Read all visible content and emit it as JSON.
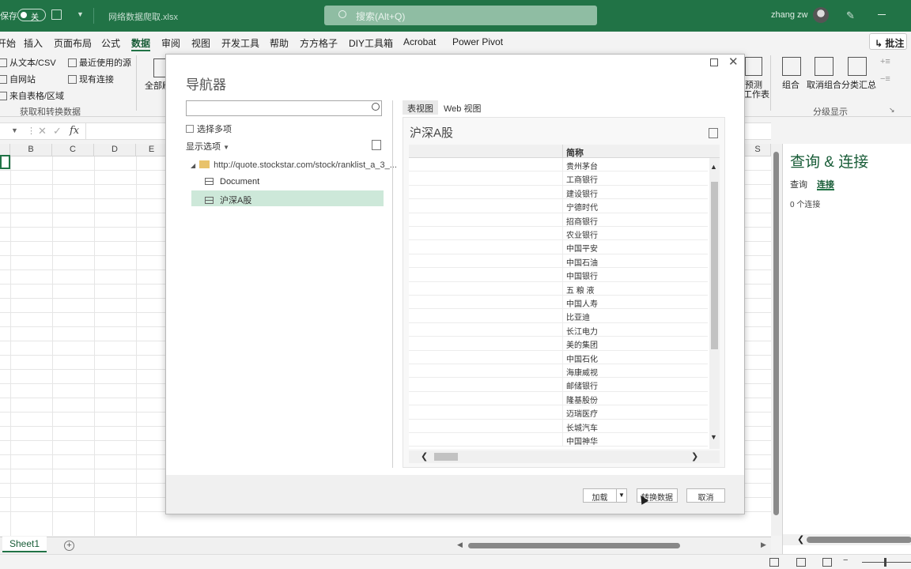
{
  "titlebar": {
    "autosave_label": "保存",
    "toggle_state": "关",
    "filename": "网络数据爬取.xlsx",
    "search_placeholder": "搜索(Alt+Q)",
    "user": "zhang zw"
  },
  "menu": {
    "items": [
      "开始",
      "插入",
      "页面布局",
      "公式",
      "数据",
      "审阅",
      "视图",
      "开发工具",
      "帮助",
      "方方格子",
      "DIY工具箱",
      "Acrobat",
      "Power Pivot"
    ],
    "active": "数据",
    "comment_button": "批注"
  },
  "ribbon": {
    "get_data": {
      "from_text_csv": "从文本/CSV",
      "recent_sources": "最近使用的源",
      "from_web": "自网站",
      "existing_connections": "现有连接",
      "from_table": "来自表格/区域",
      "group_label": "获取和转换数据"
    },
    "refresh_all": "全部刷",
    "forecast": "预测",
    "forecast_sheet": "工作表",
    "outline": {
      "group": "组合",
      "ungroup": "取消组合",
      "subtotal": "分类汇总",
      "group_label": "分级显示"
    }
  },
  "formula_bar": {
    "fx": "fx",
    "value": ""
  },
  "grid": {
    "columns": [
      "B",
      "C",
      "D",
      "E"
    ],
    "last_column": "S"
  },
  "sheet_tabs": {
    "active": "Sheet1"
  },
  "task_pane": {
    "title": "查询 & 连接",
    "tabs": [
      "查询",
      "连接"
    ],
    "active_tab": "连接",
    "connection_count": "0 个连接"
  },
  "navigator": {
    "title": "导航器",
    "search_value": "",
    "select_multiple": "选择多项",
    "display_options": "显示选项",
    "tree": {
      "root_url": "http://quote.stockstar.com/stock/ranklist_a_3_...",
      "items": [
        "Document",
        "沪深A股"
      ],
      "selected": "沪深A股"
    },
    "view_tabs": [
      "表视图",
      "Web 视图"
    ],
    "active_view": "表视图",
    "preview_title": "沪深A股",
    "table": {
      "column_header": "简称",
      "rows": [
        "贵州茅台",
        "工商银行",
        "建设银行",
        "宁德时代",
        "招商银行",
        "农业银行",
        "中国平安",
        "中国石油",
        "中国银行",
        "五 粮 液",
        "中国人寿",
        "比亚迪",
        "长江电力",
        "美的集团",
        "中国石化",
        "海康威视",
        "邮储银行",
        "隆基股份",
        "迈瑞医疗",
        "长城汽车",
        "中国神华"
      ]
    },
    "buttons": {
      "load": "加载",
      "transform": "转换数据",
      "cancel": "取消"
    }
  }
}
